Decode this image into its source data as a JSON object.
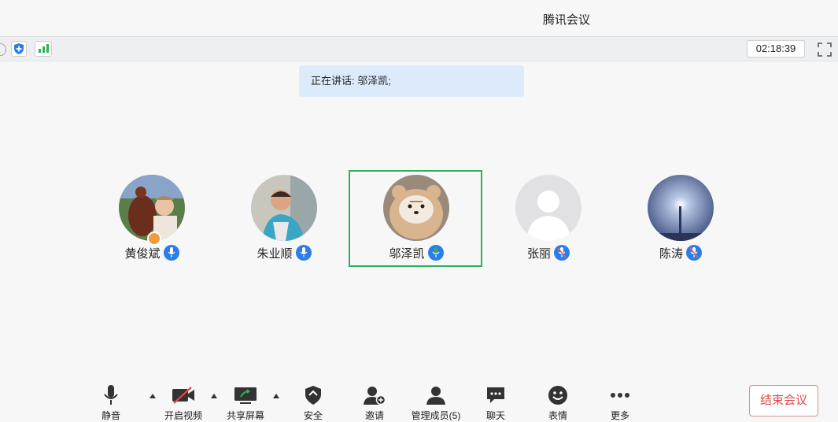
{
  "app": {
    "title": "腾讯会议"
  },
  "status": {
    "timer": "02:18:39"
  },
  "banner": {
    "speaking_text": "正在讲话: 邬泽凯;"
  },
  "participants": [
    {
      "name": "黄俊斌",
      "mic": "on",
      "host": true
    },
    {
      "name": "朱业顺",
      "mic": "on",
      "host": false
    },
    {
      "name": "邬泽凯",
      "mic": "speaking",
      "host": false
    },
    {
      "name": "张丽",
      "mic": "off",
      "host": false
    },
    {
      "name": "陈涛",
      "mic": "off",
      "host": false
    }
  ],
  "toolbar": {
    "mute": "静音",
    "video": "开启视频",
    "share": "共享屏幕",
    "security": "安全",
    "invite": "邀请",
    "members": "管理成员(5)",
    "chat": "聊天",
    "reactions": "表情",
    "more": "更多",
    "end": "结束会议"
  },
  "colors": {
    "accent_blue": "#2b7de9",
    "speaking_green": "#2fb05a",
    "end_red": "#e04848",
    "banner_bg": "#dcebfb"
  },
  "icons": {
    "mic": "microphone-icon",
    "video": "camera-off-icon",
    "share": "share-screen-icon",
    "security": "shield-icon",
    "invite": "add-person-icon",
    "members": "person-icon",
    "chat": "chat-bubble-icon",
    "reactions": "smiley-icon",
    "more": "more-dots-icon"
  }
}
